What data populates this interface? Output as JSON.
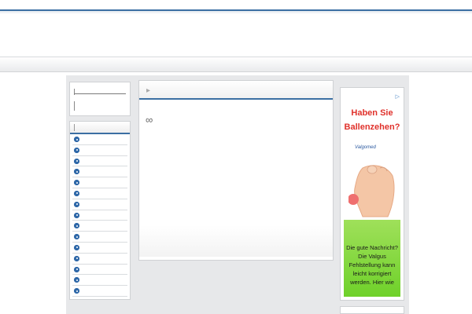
{
  "ad": {
    "close_icon": "ad-choices-icon",
    "headline": "Haben Sie Ballenzehen?",
    "brand": "Valgomed",
    "body_text": "Die gute Nachricht? Die Valgus Fehlstellung kann leicht korrigiert werden. Hier wie",
    "colors": {
      "headline": "#e0312b",
      "green": "#7ed63a"
    }
  },
  "menu": {
    "items": [
      "",
      "",
      "",
      "",
      "",
      "",
      "",
      "",
      "",
      "",
      "",
      "",
      "",
      "",
      ""
    ]
  },
  "content": {
    "glyph": "∞"
  },
  "colors": {
    "accent": "#3b6fa3",
    "background": "#e7e8ea"
  }
}
